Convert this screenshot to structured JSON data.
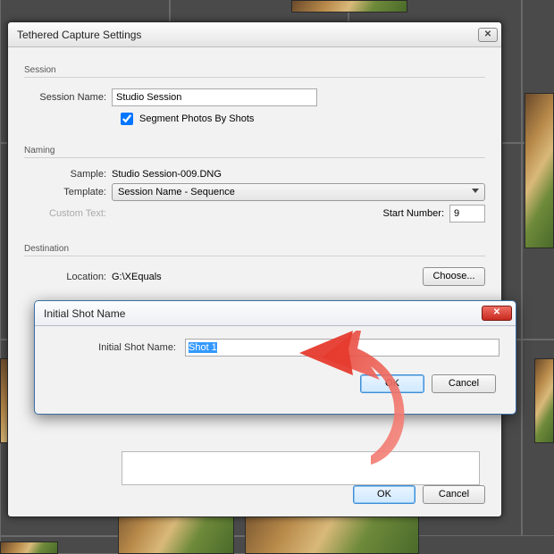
{
  "dialog": {
    "title": "Tethered Capture Settings",
    "session": {
      "groupLabel": "Session",
      "nameLabel": "Session Name:",
      "nameValue": "Studio Session",
      "segmentLabel": "Segment Photos By Shots"
    },
    "naming": {
      "groupLabel": "Naming",
      "sampleLabel": "Sample:",
      "sampleValue": "Studio Session-009.DNG",
      "templateLabel": "Template:",
      "templateValue": "Session Name - Sequence",
      "customTextLabel": "Custom Text:",
      "startNumberLabel": "Start Number:",
      "startNumberValue": "9"
    },
    "destination": {
      "groupLabel": "Destination",
      "locationLabel": "Location:",
      "locationValue": "G:\\XEquals",
      "chooseLabel": "Choose..."
    },
    "buttons": {
      "ok": "OK",
      "cancel": "Cancel"
    }
  },
  "modal": {
    "title": "Initial Shot Name",
    "fieldLabel": "Initial Shot Name:",
    "fieldValue": "Shot 1",
    "ok": "OK",
    "cancel": "Cancel"
  }
}
